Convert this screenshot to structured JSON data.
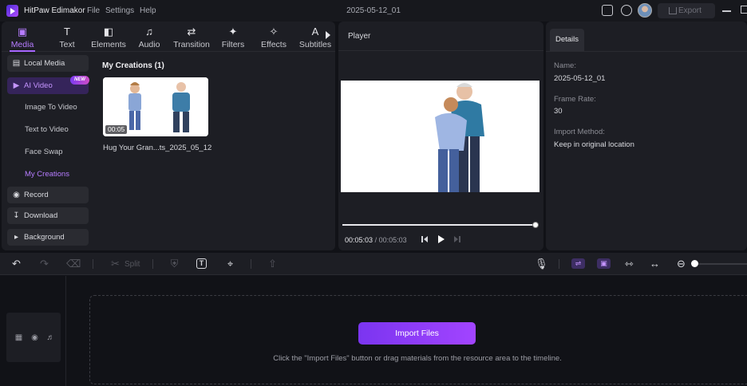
{
  "app": {
    "name": "HitPaw Edimakor",
    "menu": [
      "File",
      "Settings",
      "Help"
    ],
    "document_title": "2025-05-12_01",
    "export_label": "Export"
  },
  "media_tabs": [
    {
      "label": "Media",
      "icon": "media-icon",
      "active": true
    },
    {
      "label": "Text",
      "icon": "text-icon"
    },
    {
      "label": "Elements",
      "icon": "elements-icon"
    },
    {
      "label": "Audio",
      "icon": "audio-icon"
    },
    {
      "label": "Transition",
      "icon": "transition-icon"
    },
    {
      "label": "Filters",
      "icon": "filters-icon"
    },
    {
      "label": "Effects",
      "icon": "effects-icon"
    },
    {
      "label": "Subtitles",
      "icon": "subtitles-icon"
    }
  ],
  "sidebar": {
    "local_media": "Local Media",
    "ai_video": "AI Video",
    "new_badge": "NEW",
    "sub_items": [
      "Image To Video",
      "Text to Video",
      "Face Swap",
      "My Creations"
    ],
    "record": "Record",
    "download": "Download",
    "background": "Background"
  },
  "library": {
    "section_title": "My Creations (1)",
    "items": [
      {
        "name": "Hug Your Gran...ts_2025_05_12",
        "duration": "00:05"
      }
    ]
  },
  "player": {
    "title": "Player",
    "current_time": "00:05:03",
    "total_time": "/ 00:05:03",
    "progress": 1.0
  },
  "details": {
    "tab": "Details",
    "fields": [
      {
        "label": "Name:",
        "value": "2025-05-12_01"
      },
      {
        "label": "Frame Rate:",
        "value": "30"
      },
      {
        "label": "Import Method:",
        "value": "Keep in original location"
      }
    ]
  },
  "toolbar": {
    "split_label": "Split"
  },
  "timeline": {
    "import_button": "Import Files",
    "hint": "Click the \"Import Files\" button or drag materials from the resource area to the timeline."
  },
  "colors": {
    "accent": "#a766ff",
    "background": "#111217",
    "panel": "#1d1e24"
  }
}
